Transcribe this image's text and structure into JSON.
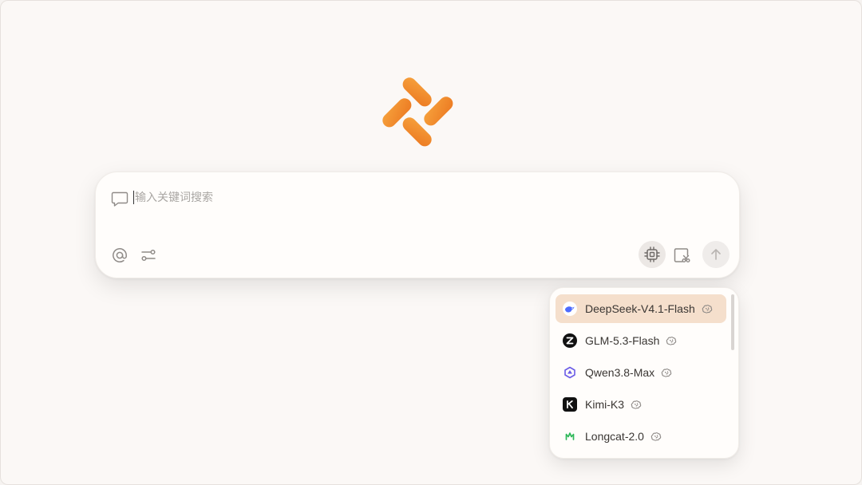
{
  "search": {
    "placeholder": "输入关键词搜索",
    "value": ""
  },
  "colors": {
    "accent": "#f08a2c",
    "selected_row": "#f5dfcc",
    "background": "#fbf8f6"
  },
  "toolbar": {
    "left": [
      {
        "name": "at-icon"
      },
      {
        "name": "sliders-icon"
      }
    ],
    "right": [
      {
        "name": "chip-icon",
        "active": true
      },
      {
        "name": "screenshot-icon"
      },
      {
        "name": "arrow-up-icon"
      }
    ]
  },
  "model_menu": {
    "items": [
      {
        "label": "DeepSeek-V4.1-Flash",
        "icon": "deepseek-whale-icon",
        "selected": true
      },
      {
        "label": "GLM-5.3-Flash",
        "icon": "glm-z-icon",
        "selected": false
      },
      {
        "label": "Qwen3.8-Max",
        "icon": "qwen-icon",
        "selected": false
      },
      {
        "label": "Kimi-K3",
        "icon": "kimi-k-icon",
        "selected": false
      },
      {
        "label": "Longcat-2.0",
        "icon": "longcat-icon",
        "selected": false
      }
    ]
  }
}
